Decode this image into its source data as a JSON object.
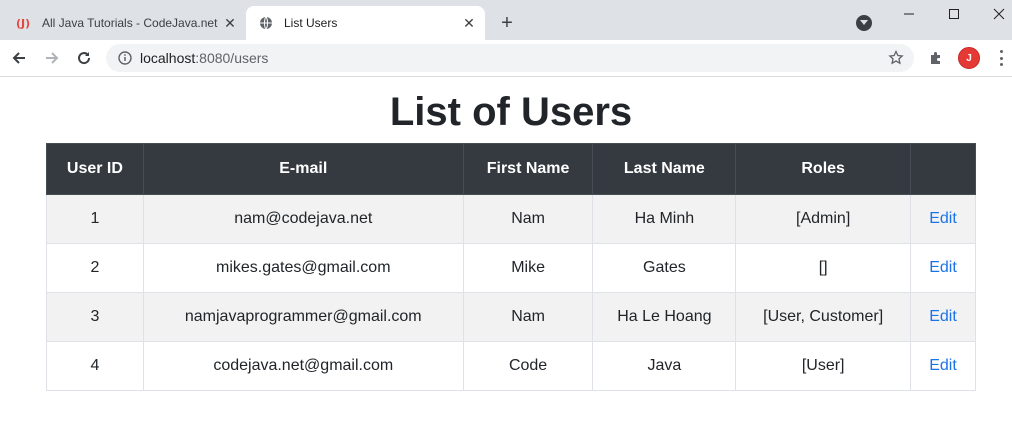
{
  "browser": {
    "tabs": [
      {
        "title": "All Java Tutorials - CodeJava.net",
        "active": false,
        "favicon": "codejava-icon"
      },
      {
        "title": "List Users",
        "active": true,
        "favicon": "globe-icon"
      }
    ],
    "url_host": "localhost",
    "url_rest": ":8080/users",
    "profile_initial": "J"
  },
  "page": {
    "title": "List of Users",
    "columns": [
      "User ID",
      "E-mail",
      "First Name",
      "Last Name",
      "Roles",
      ""
    ],
    "users": [
      {
        "id": "1",
        "email": "nam@codejava.net",
        "first_name": "Nam",
        "last_name": "Ha Minh",
        "roles": "[Admin]",
        "action": "Edit"
      },
      {
        "id": "2",
        "email": "mikes.gates@gmail.com",
        "first_name": "Mike",
        "last_name": "Gates",
        "roles": "[]",
        "action": "Edit"
      },
      {
        "id": "3",
        "email": "namjavaprogrammer@gmail.com",
        "first_name": "Nam",
        "last_name": "Ha Le Hoang",
        "roles": "[User, Customer]",
        "action": "Edit"
      },
      {
        "id": "4",
        "email": "codejava.net@gmail.com",
        "first_name": "Code",
        "last_name": "Java",
        "roles": "[User]",
        "action": "Edit"
      }
    ]
  },
  "colors": {
    "header_bg": "#343a40",
    "link": "#1a73e8",
    "stripe": "#f2f2f2"
  }
}
